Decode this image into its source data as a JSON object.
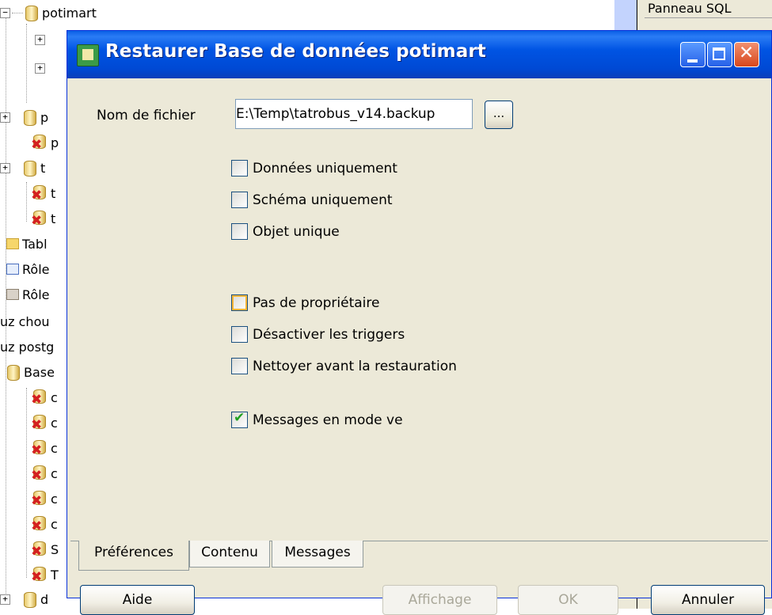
{
  "tree": {
    "root_label": "potimart",
    "partial_labels": [
      "p",
      "p",
      "t",
      "t",
      "t",
      "Tabl",
      "Rôle",
      "Rôle",
      "uz chou",
      "uz postg",
      "Base",
      "c",
      "c",
      "c",
      "c",
      "c",
      "c",
      "S",
      "T",
      "d"
    ]
  },
  "right_pane": {
    "title": "Panneau SQL"
  },
  "dialog": {
    "title": "Restaurer Base de données potimart",
    "file_label": "Nom de fichier",
    "file_value": "E:\\Temp\\tatrobus_v14.backup",
    "browse_label": "...",
    "checkboxes": [
      {
        "label": "Données uniquement",
        "checked": false
      },
      {
        "label": "Schéma uniquement",
        "checked": false
      },
      {
        "label": "Objet unique",
        "checked": false
      },
      {
        "label": "Pas de propriétaire",
        "checked": false
      },
      {
        "label": "Désactiver les triggers",
        "checked": false
      },
      {
        "label": "Nettoyer avant la restauration",
        "checked": false
      },
      {
        "label": "Messages en mode ve",
        "checked": true
      }
    ],
    "tabs": [
      "Préférences",
      "Contenu",
      "Messages"
    ],
    "active_tab": "Préférences",
    "buttons": {
      "help": "Aide",
      "display": "Affichage",
      "ok": "OK",
      "cancel": "Annuler"
    }
  }
}
